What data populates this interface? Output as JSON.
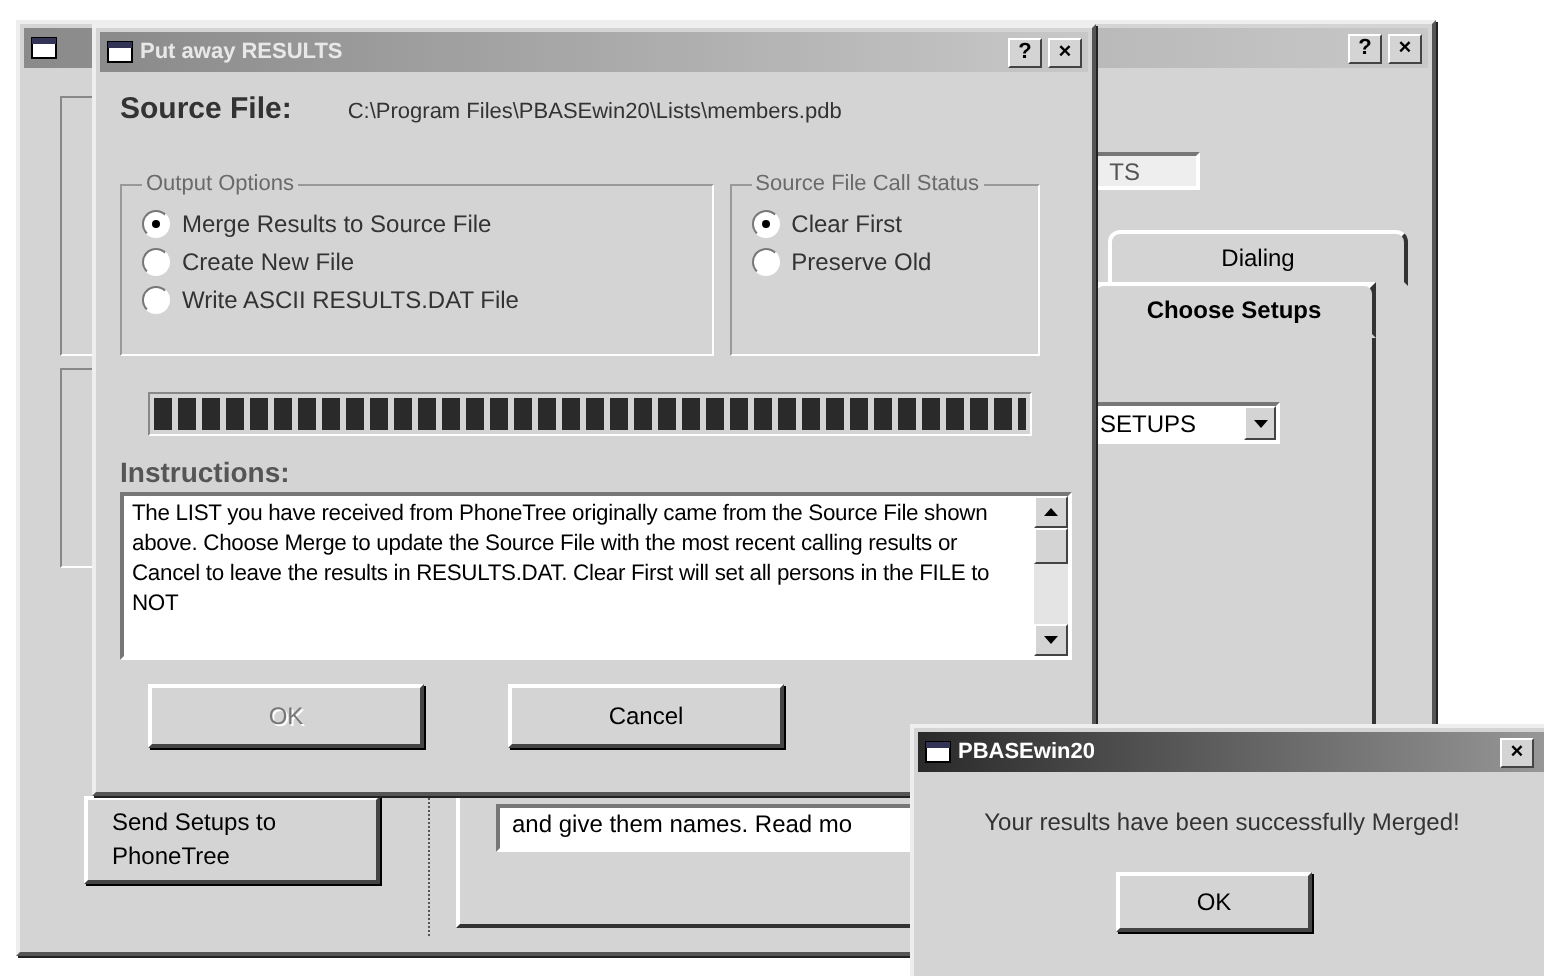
{
  "background_window": {
    "help_button": "?",
    "close_button": "×",
    "text_field": {
      "value": "TS"
    },
    "send_button": "Send Setups to PhoneTree",
    "tabs": [
      {
        "label": "Dialing",
        "selected": false
      },
      {
        "label": "Choose Setups",
        "selected": true
      }
    ],
    "setups_dropdown": {
      "value": "SETUPS"
    },
    "notes_text": "and give them names.  Read mo"
  },
  "results_dialog": {
    "title": "Put away RESULTS",
    "help_button": "?",
    "close_button": "×",
    "source_file_label": "Source File:",
    "source_file_path": "C:\\Program Files\\PBASEwin20\\Lists\\members.pdb",
    "output_options": {
      "title": "Output Options",
      "options": [
        {
          "label": "Merge Results to Source File",
          "selected": true
        },
        {
          "label": "Create New File",
          "selected": false
        },
        {
          "label": "Write ASCII RESULTS.DAT File",
          "selected": false
        }
      ]
    },
    "call_status": {
      "title": "Source File Call Status",
      "options": [
        {
          "label": "Clear First",
          "selected": true
        },
        {
          "label": "Preserve Old",
          "selected": false
        }
      ]
    },
    "progress": {
      "level": 1
    },
    "instructions_label": "Instructions:",
    "instructions_text": "The LIST you have received from PhoneTree originally came from the Source File shown above.  Choose Merge to update the Source File with the most recent  calling results or Cancel to leave the results in RESULTS.DAT.  Clear First will set all  persons  in the FILE to NOT",
    "buttons": [
      {
        "label": "OK",
        "disabled": true
      },
      {
        "label": "Cancel",
        "disabled": false
      }
    ]
  },
  "message_box": {
    "title": "PBASEwin20",
    "close_button": "×",
    "message": "Your results have been successfully Merged!",
    "button": "OK"
  }
}
